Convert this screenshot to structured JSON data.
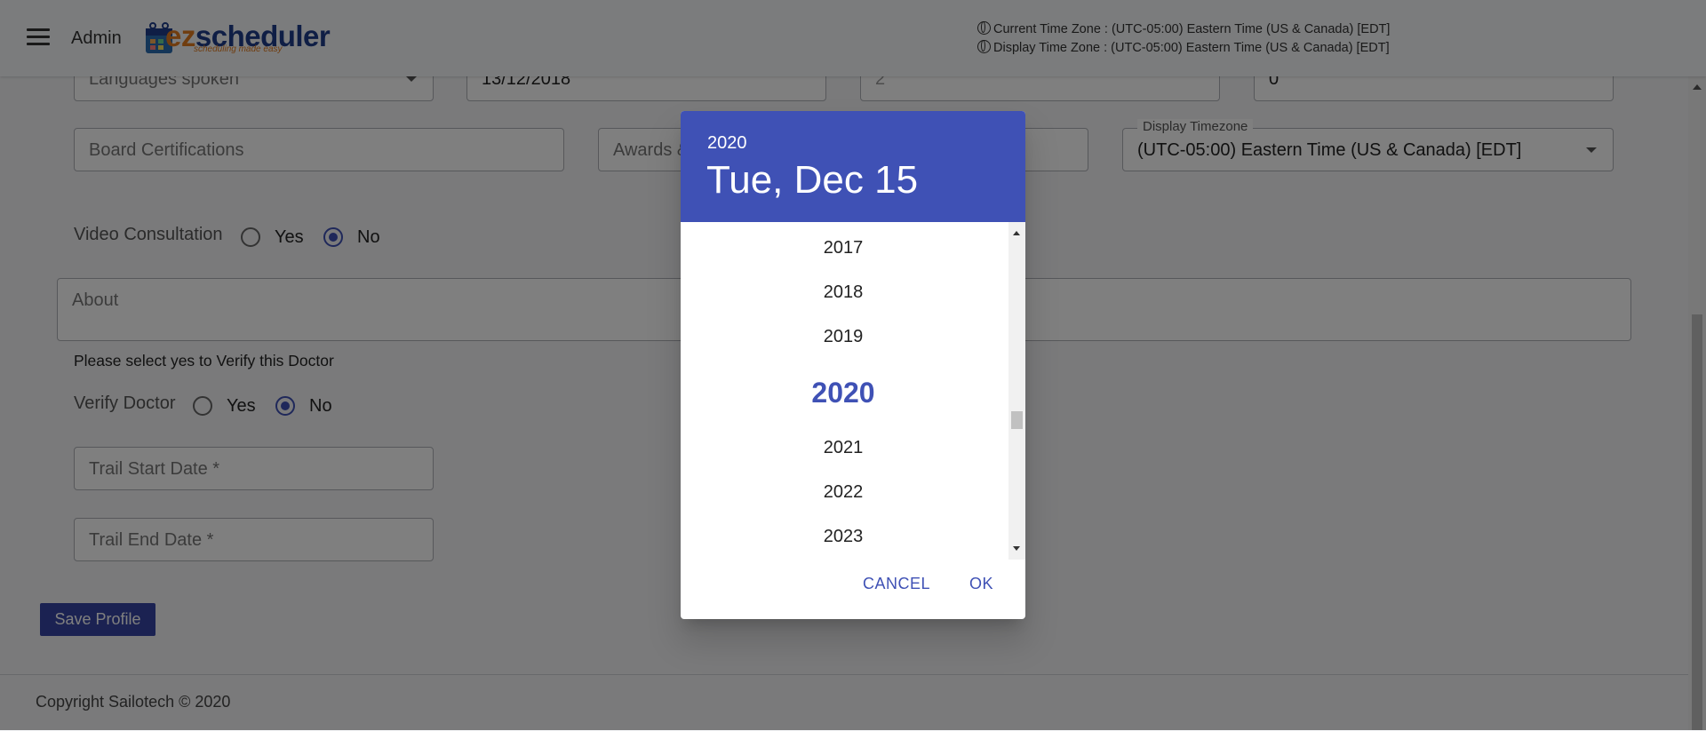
{
  "header": {
    "admin_label": "Admin",
    "logo_text_ez": "ez",
    "logo_text_rest": "scheduler",
    "logo_tagline": "scheduling made easy",
    "current_tz": "Current Time Zone : (UTC-05:00) Eastern Time (US & Canada) [EDT]",
    "display_tz": "Display Time Zone : (UTC-05:00) Eastern Time (US & Canada) [EDT]"
  },
  "form": {
    "languages_placeholder": "Languages spoken",
    "date_value": "13/12/2018",
    "field3_value": "2",
    "field4_value": "0",
    "board_certifications_placeholder": "Board Certifications",
    "awards_placeholder": "Awards &",
    "display_timezone_label": "Display Timezone",
    "display_timezone_value": "(UTC-05:00) Eastern Time (US & Canada) [EDT]",
    "video_consultation_label": "Video Consultation",
    "video_yes": "Yes",
    "video_no": "No",
    "about_placeholder": "About",
    "verify_note": "Please select yes to Verify this Doctor",
    "verify_label": "Verify Doctor",
    "verify_yes": "Yes",
    "verify_no": "No",
    "trail_start_placeholder": "Trail Start Date *",
    "trail_end_placeholder": "Trail End Date *",
    "save_label": "Save Profile"
  },
  "footer": {
    "copyright": "Copyright Sailotech © 2020"
  },
  "date_picker": {
    "header_year": "2020",
    "header_date": "Tue, Dec 15",
    "years": [
      "2017",
      "2018",
      "2019",
      "2020",
      "2021",
      "2022",
      "2023"
    ],
    "selected_year": "2020",
    "cancel_label": "CANCEL",
    "ok_label": "OK",
    "accent_color": "#3f51b5"
  }
}
